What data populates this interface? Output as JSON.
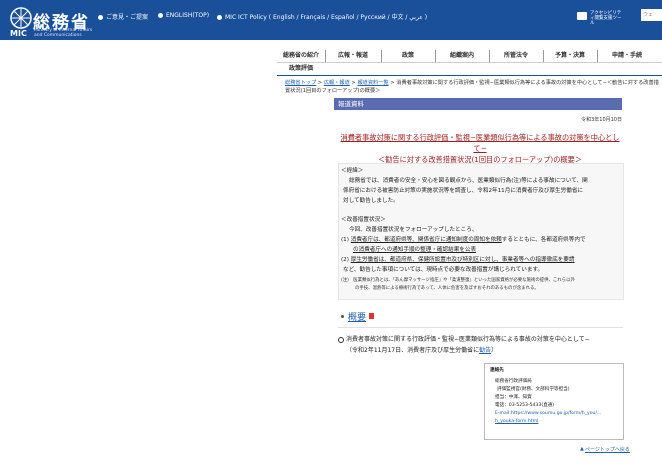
{
  "header": {
    "logo_title": "総務省",
    "logo_abbr": "MIC",
    "logo_sub": "Ministry of Internal Affairs and Communications",
    "links": [
      "ご意見・ご提案",
      "ENGLISH(TOP)",
      "MIC ICT Policy ( English / Français / Español / Русский / 中文 / عربي )"
    ],
    "accessibility": "アクセシビリティ閲覧支援ツール",
    "search_placeholder": "ウェ"
  },
  "nav": {
    "items": [
      "総務省の紹介",
      "広報・報道",
      "政策",
      "組織案内",
      "所管法令",
      "予算・決算",
      "申請・手続",
      "政策評価"
    ]
  },
  "breadcrumb": {
    "items": [
      "総務省トップ",
      "広報・報道",
      "報道資料一覧"
    ],
    "current": "消費者事故対策に関する行政評価・監視−医業類似行為等による事故の対策を中心として−＜勧告に対する改善措置状況(1回目のフォローアップ)の概要＞",
    "separator": ">"
  },
  "press": {
    "label": "報道資料",
    "date": "令和3年10月10日",
    "title_line1": "消費者事故対策に関する行政評価・監視−医業類似行為等による事故の対策を中心として−",
    "title_line2": "＜勧告に対する改善措置状況(1回目のフォローアップ)の概要＞"
  },
  "body_box": {
    "h1": "＜経緯＞",
    "p1_line1": "総務省では、消費者の安全・安心を図る観点から、医業類似行為(注)等による事故について、関",
    "p1_line2": "係府省における被害防止対策の実施状況等を調査し、令和2年11月に消費者庁及び厚生労働省に",
    "p1_line3": "対して勧告しました。",
    "h2": "＜改善措置状況＞",
    "p2_line1": "今回、改善措置状況をフォローアップしたところ、",
    "item1_prefix": "(1)",
    "item1_underline": "消費者庁は、都道府県等、関係省庁に通知制度の周知を依頼",
    "item1_rest": "するとともに、各都道府県等内で",
    "item1_line2": "の消費者庁への通知手順の整理・確認結果を公表",
    "item2_prefix": "(2)",
    "item2_underline": "厚生労働省は、都道府県、保健所設置市及び特別区に対し、事業者等への指導徹底を要請",
    "item3_line": "など、勧告した事項については、現時点で必要な改善措置が講じられています。",
    "note_line1": "(注)　医業類似行為とは、「あん摩マッサージ指圧」や「柔道整復」といった国家資格が必要な施術の提供、これら以外",
    "note_line2": "の手技、温熱等による療術行為であって、人体に危害を及ぼすおそれのあるものが含まれる。"
  },
  "overview": {
    "label": "概要",
    "pdf_icon": "pdf-icon"
  },
  "related": {
    "line1": "消費者事故対策に関する行政評価・監視−医業類似行為等による事故の対策を中心として−",
    "line2_prefix": "（令和2年11月17日、消費者庁及び厚生労働省に",
    "link": "勧告",
    "line2_suffix": "）"
  },
  "contact": {
    "heading": "連絡先",
    "org": "総務省行政評価局",
    "dept": "評価監視官(財務、文部科学等担当)",
    "person": "担当：中澤、知賀",
    "tel": "電話：03-5253-5433(直通)",
    "email_line1": "E-mail:https://www.soumu.go.jp/form/h_you/...",
    "email_line2": "h_youka-form.html"
  },
  "footer": {
    "pagetop": "ページトップへ戻る"
  },
  "colors": {
    "header_bg": "#1a4f9a",
    "press_bar": "#5b6bb0",
    "title_red": "#a02020",
    "link_blue": "#1a5fb4"
  }
}
